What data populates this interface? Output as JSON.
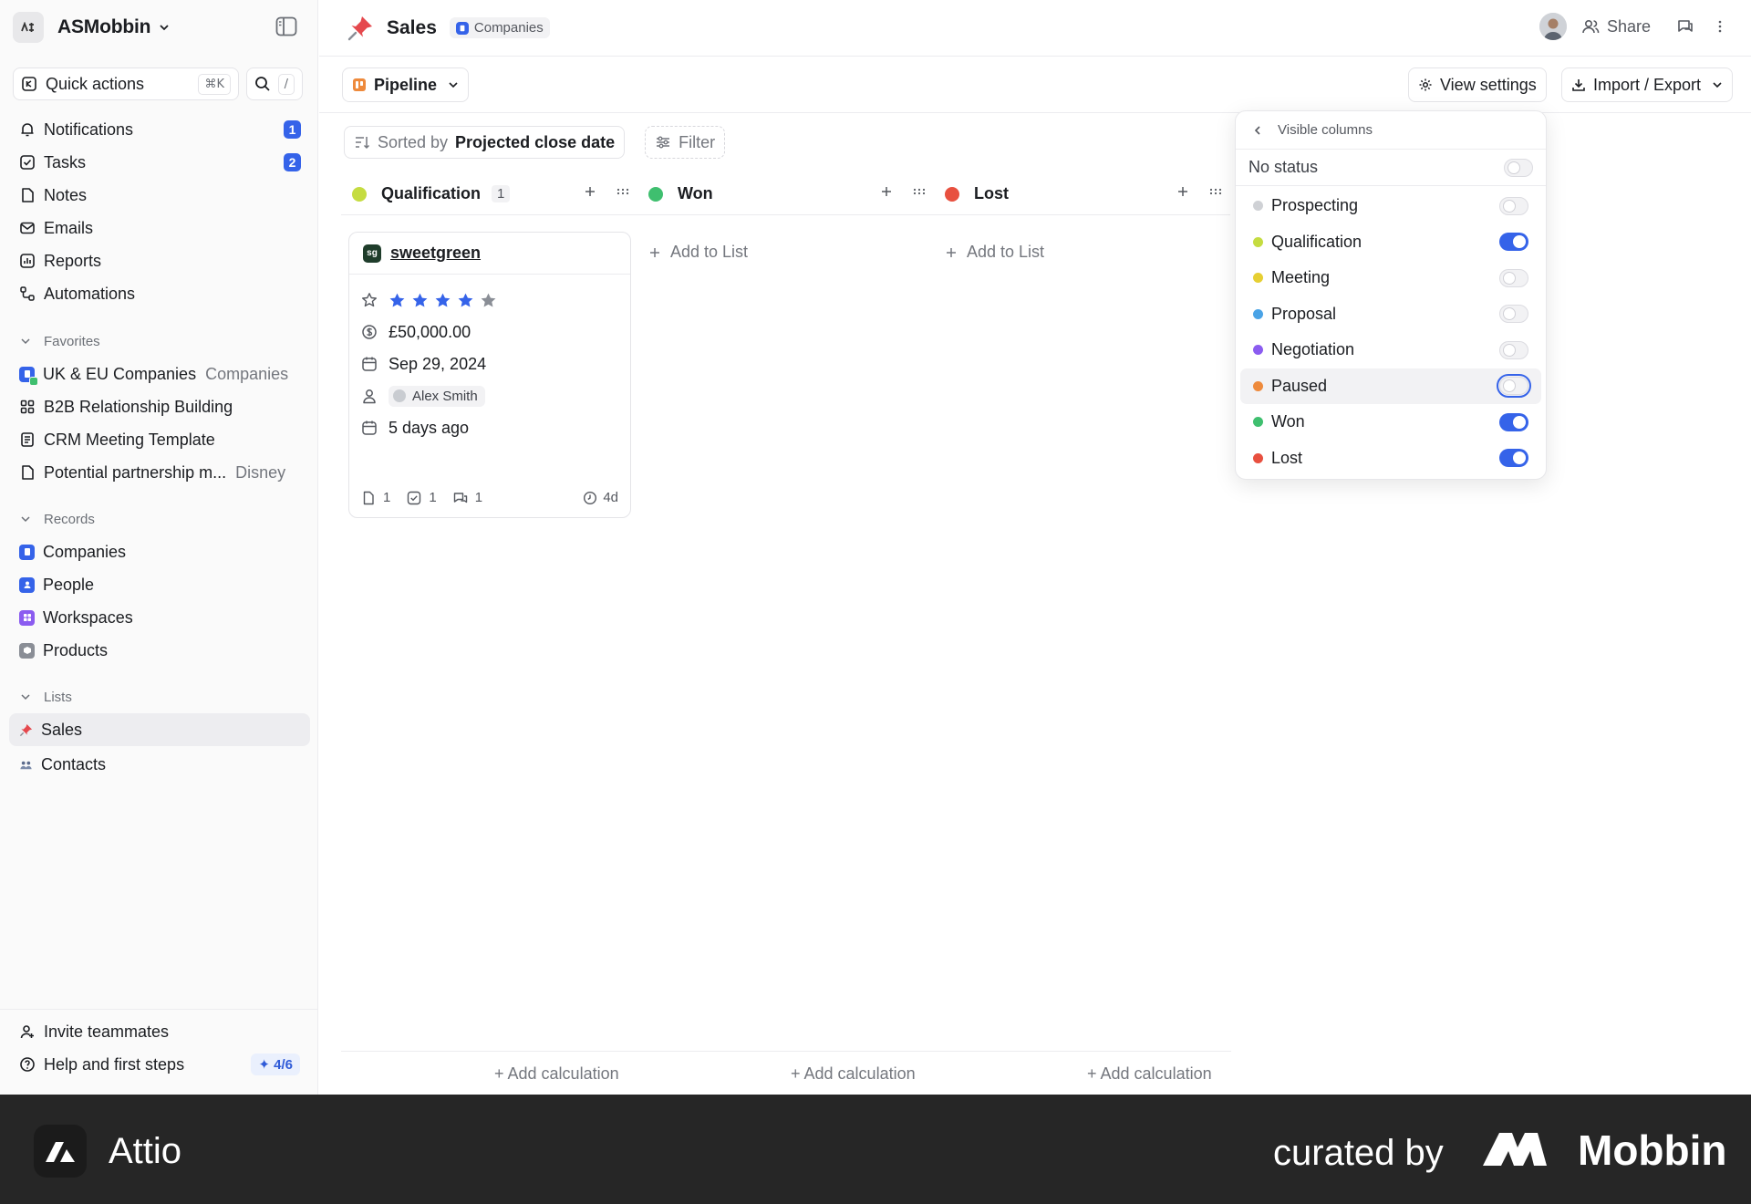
{
  "workspace": {
    "logo_text": "ᴬˢ",
    "name": "ASMobbin"
  },
  "quick_actions": {
    "label": "Quick actions",
    "shortcut": "⌘K",
    "search_shortcut": "/"
  },
  "nav": {
    "notifications": {
      "label": "Notifications",
      "badge": "1"
    },
    "tasks": {
      "label": "Tasks",
      "badge": "2"
    },
    "notes": "Notes",
    "emails": "Emails",
    "reports": "Reports",
    "automations": "Automations"
  },
  "favorites": {
    "header": "Favorites",
    "items": [
      {
        "label": "UK & EU Companies",
        "sub": "Companies"
      },
      {
        "label": "B2B Relationship Building",
        "sub": ""
      },
      {
        "label": "CRM Meeting Template",
        "sub": ""
      },
      {
        "label": "Potential partnership m...",
        "sub": "Disney"
      }
    ]
  },
  "records": {
    "header": "Records",
    "items": [
      "Companies",
      "People",
      "Workspaces",
      "Products"
    ]
  },
  "lists": {
    "header": "Lists",
    "items": [
      "Sales",
      "Contacts"
    ]
  },
  "sidebar_bottom": {
    "invite": "Invite teammates",
    "help": "Help and first steps",
    "progress": "4/6"
  },
  "topbar": {
    "title": "Sales",
    "object_chip": "Companies",
    "share": "Share"
  },
  "toolbar": {
    "view": "Pipeline",
    "view_settings": "View settings",
    "import_export": "Import / Export"
  },
  "filterbar": {
    "sorted_by": "Sorted by",
    "sort_field": "Projected close date",
    "filter": "Filter"
  },
  "columns": [
    {
      "title": "Qualification",
      "count": "1",
      "color": "#c5dc41"
    },
    {
      "title": "Won",
      "count": "",
      "color": "#3fbf6f",
      "add_label": "Add to List"
    },
    {
      "title": "Lost",
      "count": "",
      "color": "#e8503f",
      "add_label": "Add to List"
    }
  ],
  "card": {
    "name": "sweetgreen",
    "logo_text": "sg",
    "rating": 4,
    "rating_max": 5,
    "amount": "£50,000.00",
    "date": "Sep 29, 2024",
    "owner": "Alex Smith",
    "last_activity": "5 days ago",
    "notes_count": "1",
    "tasks_count": "1",
    "comments_count": "1",
    "age": "4d"
  },
  "calc_label": "+ Add calculation",
  "popover": {
    "title": "Visible columns",
    "no_status": "No status",
    "items": [
      {
        "label": "Prospecting",
        "color": "#cfd1d5",
        "on": false
      },
      {
        "label": "Qualification",
        "color": "#c5dc41",
        "on": true
      },
      {
        "label": "Meeting",
        "color": "#e6cf33",
        "on": false
      },
      {
        "label": "Proposal",
        "color": "#4aa3e6",
        "on": false
      },
      {
        "label": "Negotiation",
        "color": "#8b5cf0",
        "on": false
      },
      {
        "label": "Paused",
        "color": "#ee8a3c",
        "on": false
      },
      {
        "label": "Won",
        "color": "#3fbf6f",
        "on": true
      },
      {
        "label": "Lost",
        "color": "#e8503f",
        "on": true
      }
    ]
  },
  "banner": {
    "brand": "Attio",
    "curated_by": "curated by",
    "mobbin": "Mobbin"
  }
}
